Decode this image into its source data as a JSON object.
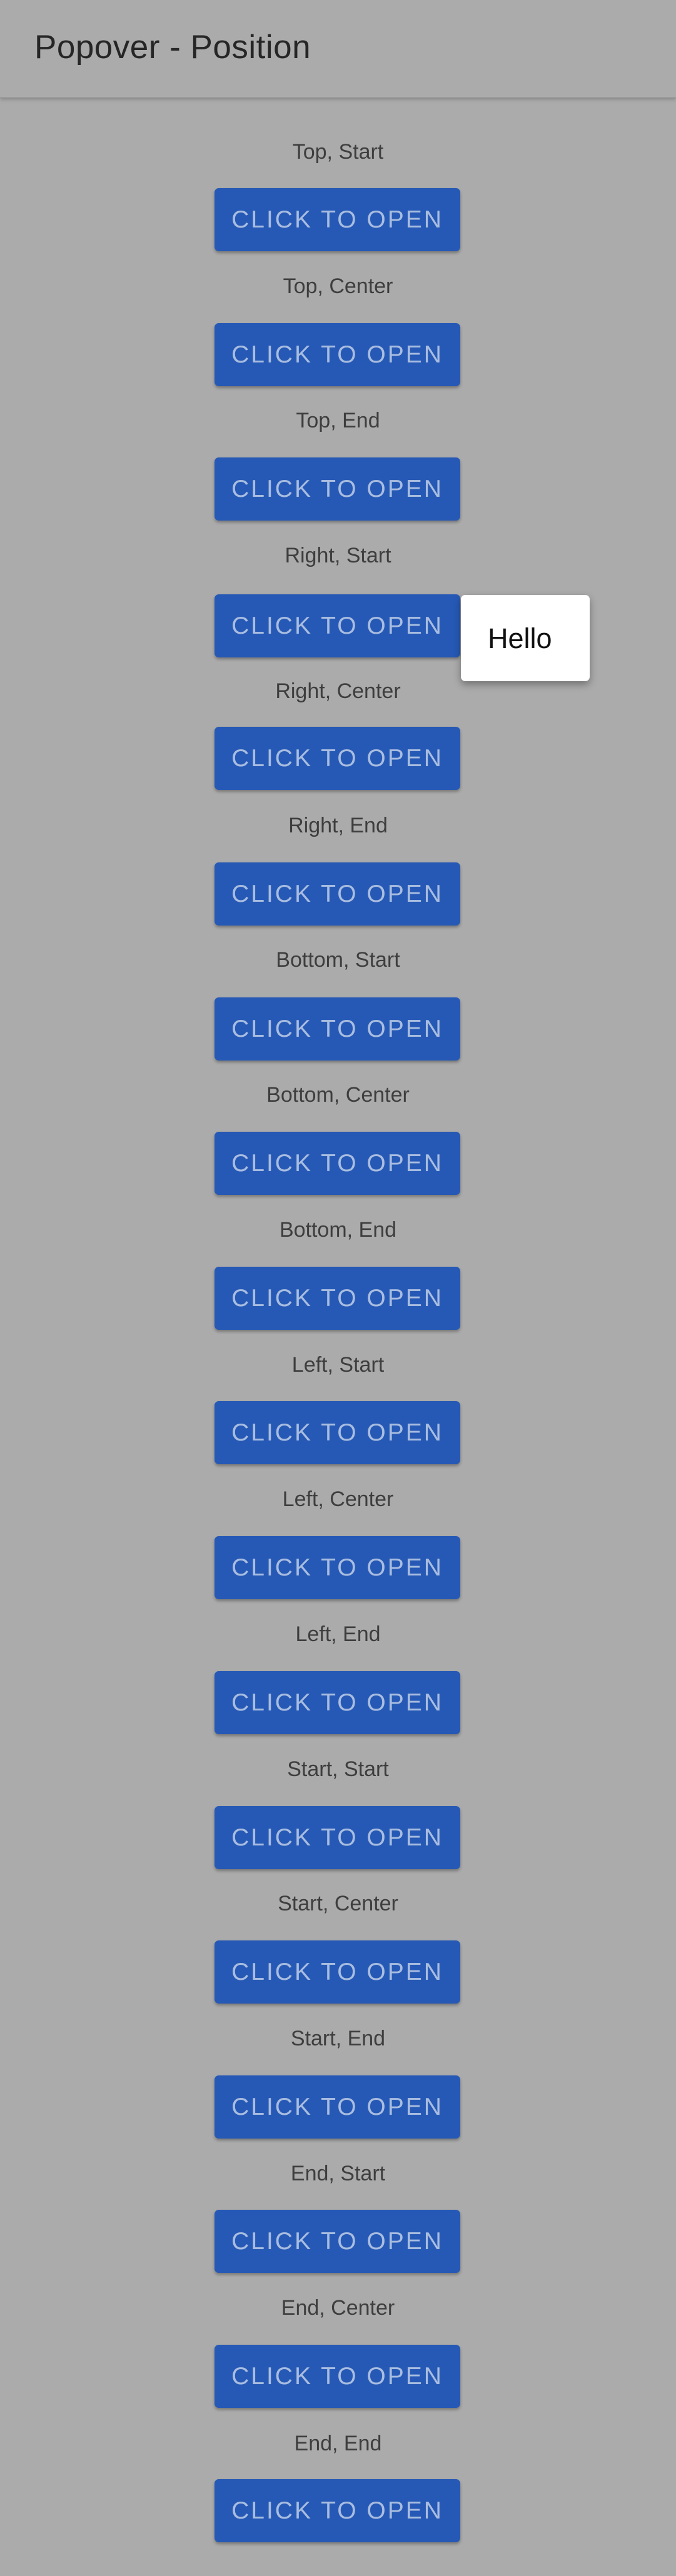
{
  "toolbar": {
    "title": "Popover - Position"
  },
  "button_label": "CLICK TO OPEN",
  "sections": [
    {
      "label": "Top, Start"
    },
    {
      "label": "Top, Center"
    },
    {
      "label": "Top, End"
    },
    {
      "label": "Right, Start"
    },
    {
      "label": "Right, Center"
    },
    {
      "label": "Right, End"
    },
    {
      "label": "Bottom, Start"
    },
    {
      "label": "Bottom, Center"
    },
    {
      "label": "Bottom, End"
    },
    {
      "label": "Left, Start"
    },
    {
      "label": "Left, Center"
    },
    {
      "label": "Left, End"
    },
    {
      "label": "Start, Start"
    },
    {
      "label": "Start, Center"
    },
    {
      "label": "Start, End"
    },
    {
      "label": "End, Start"
    },
    {
      "label": "End, Center"
    },
    {
      "label": "End, End"
    }
  ],
  "popover": {
    "text": "Hello",
    "open_for": "Right, Start"
  },
  "colors": {
    "page_background": "#ababab",
    "button_background": "#2659b5",
    "button_text": "#a9bde0",
    "popover_background": "#ffffff"
  }
}
